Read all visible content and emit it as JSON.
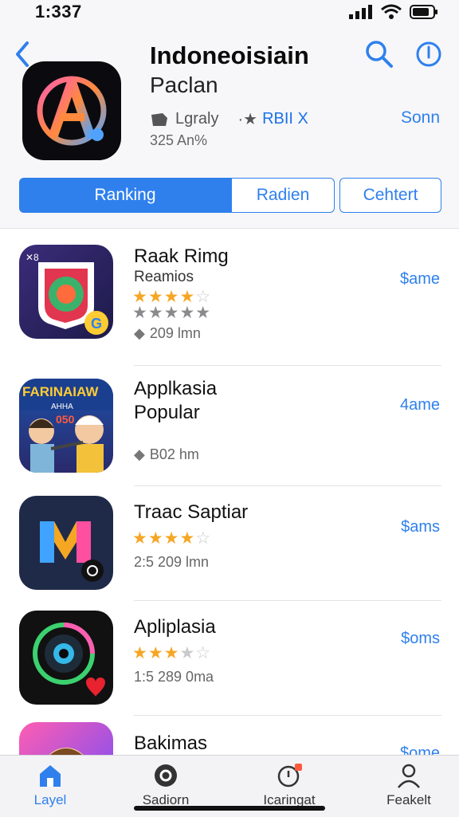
{
  "status": {
    "time": "1:337"
  },
  "header": {
    "back_icon": "chevron-left-icon",
    "search_icon": "search-icon",
    "info_icon": "info-icon"
  },
  "app": {
    "title": "Indoneoisiain",
    "subtitle": "Paclan",
    "developer": "Lgraly",
    "rank": "RBII X",
    "size": "325 An%",
    "get_label": "Sonn"
  },
  "segments": [
    "Ranking",
    "Radien",
    "Cehtert"
  ],
  "list": [
    {
      "title": "Raak Rimg",
      "subtitle": "Reamios",
      "rating": 4,
      "info": "209 lmn",
      "price": "$ame"
    },
    {
      "title": "Applkasia Popular",
      "subtitle": "",
      "rating": 0,
      "info": "B02 hm",
      "price": "4ame",
      "badge": "FARINAIAW",
      "badge_small": "AHHA",
      "badge_num": "050"
    },
    {
      "title": "Traac Saptiar",
      "subtitle": "",
      "rating": 4,
      "info": "2:5 209 lmn",
      "price": "$ams"
    },
    {
      "title": "Apliplasia",
      "subtitle": "",
      "rating": 3,
      "info": "1:5 289 0ma",
      "price": "$oms"
    },
    {
      "title": "Bakimas",
      "subtitle": "",
      "rating": 0,
      "info": "",
      "price": "$ome"
    }
  ],
  "tabs": [
    {
      "label": "Layel",
      "icon": "home-icon"
    },
    {
      "label": "Sadiorn",
      "icon": "game-controller-icon"
    },
    {
      "label": "Icaringat",
      "icon": "notifications-icon"
    },
    {
      "label": "Feakelt",
      "icon": "profile-icon"
    }
  ],
  "colors": {
    "accent": "#2f80ed",
    "star": "#f5a623"
  }
}
